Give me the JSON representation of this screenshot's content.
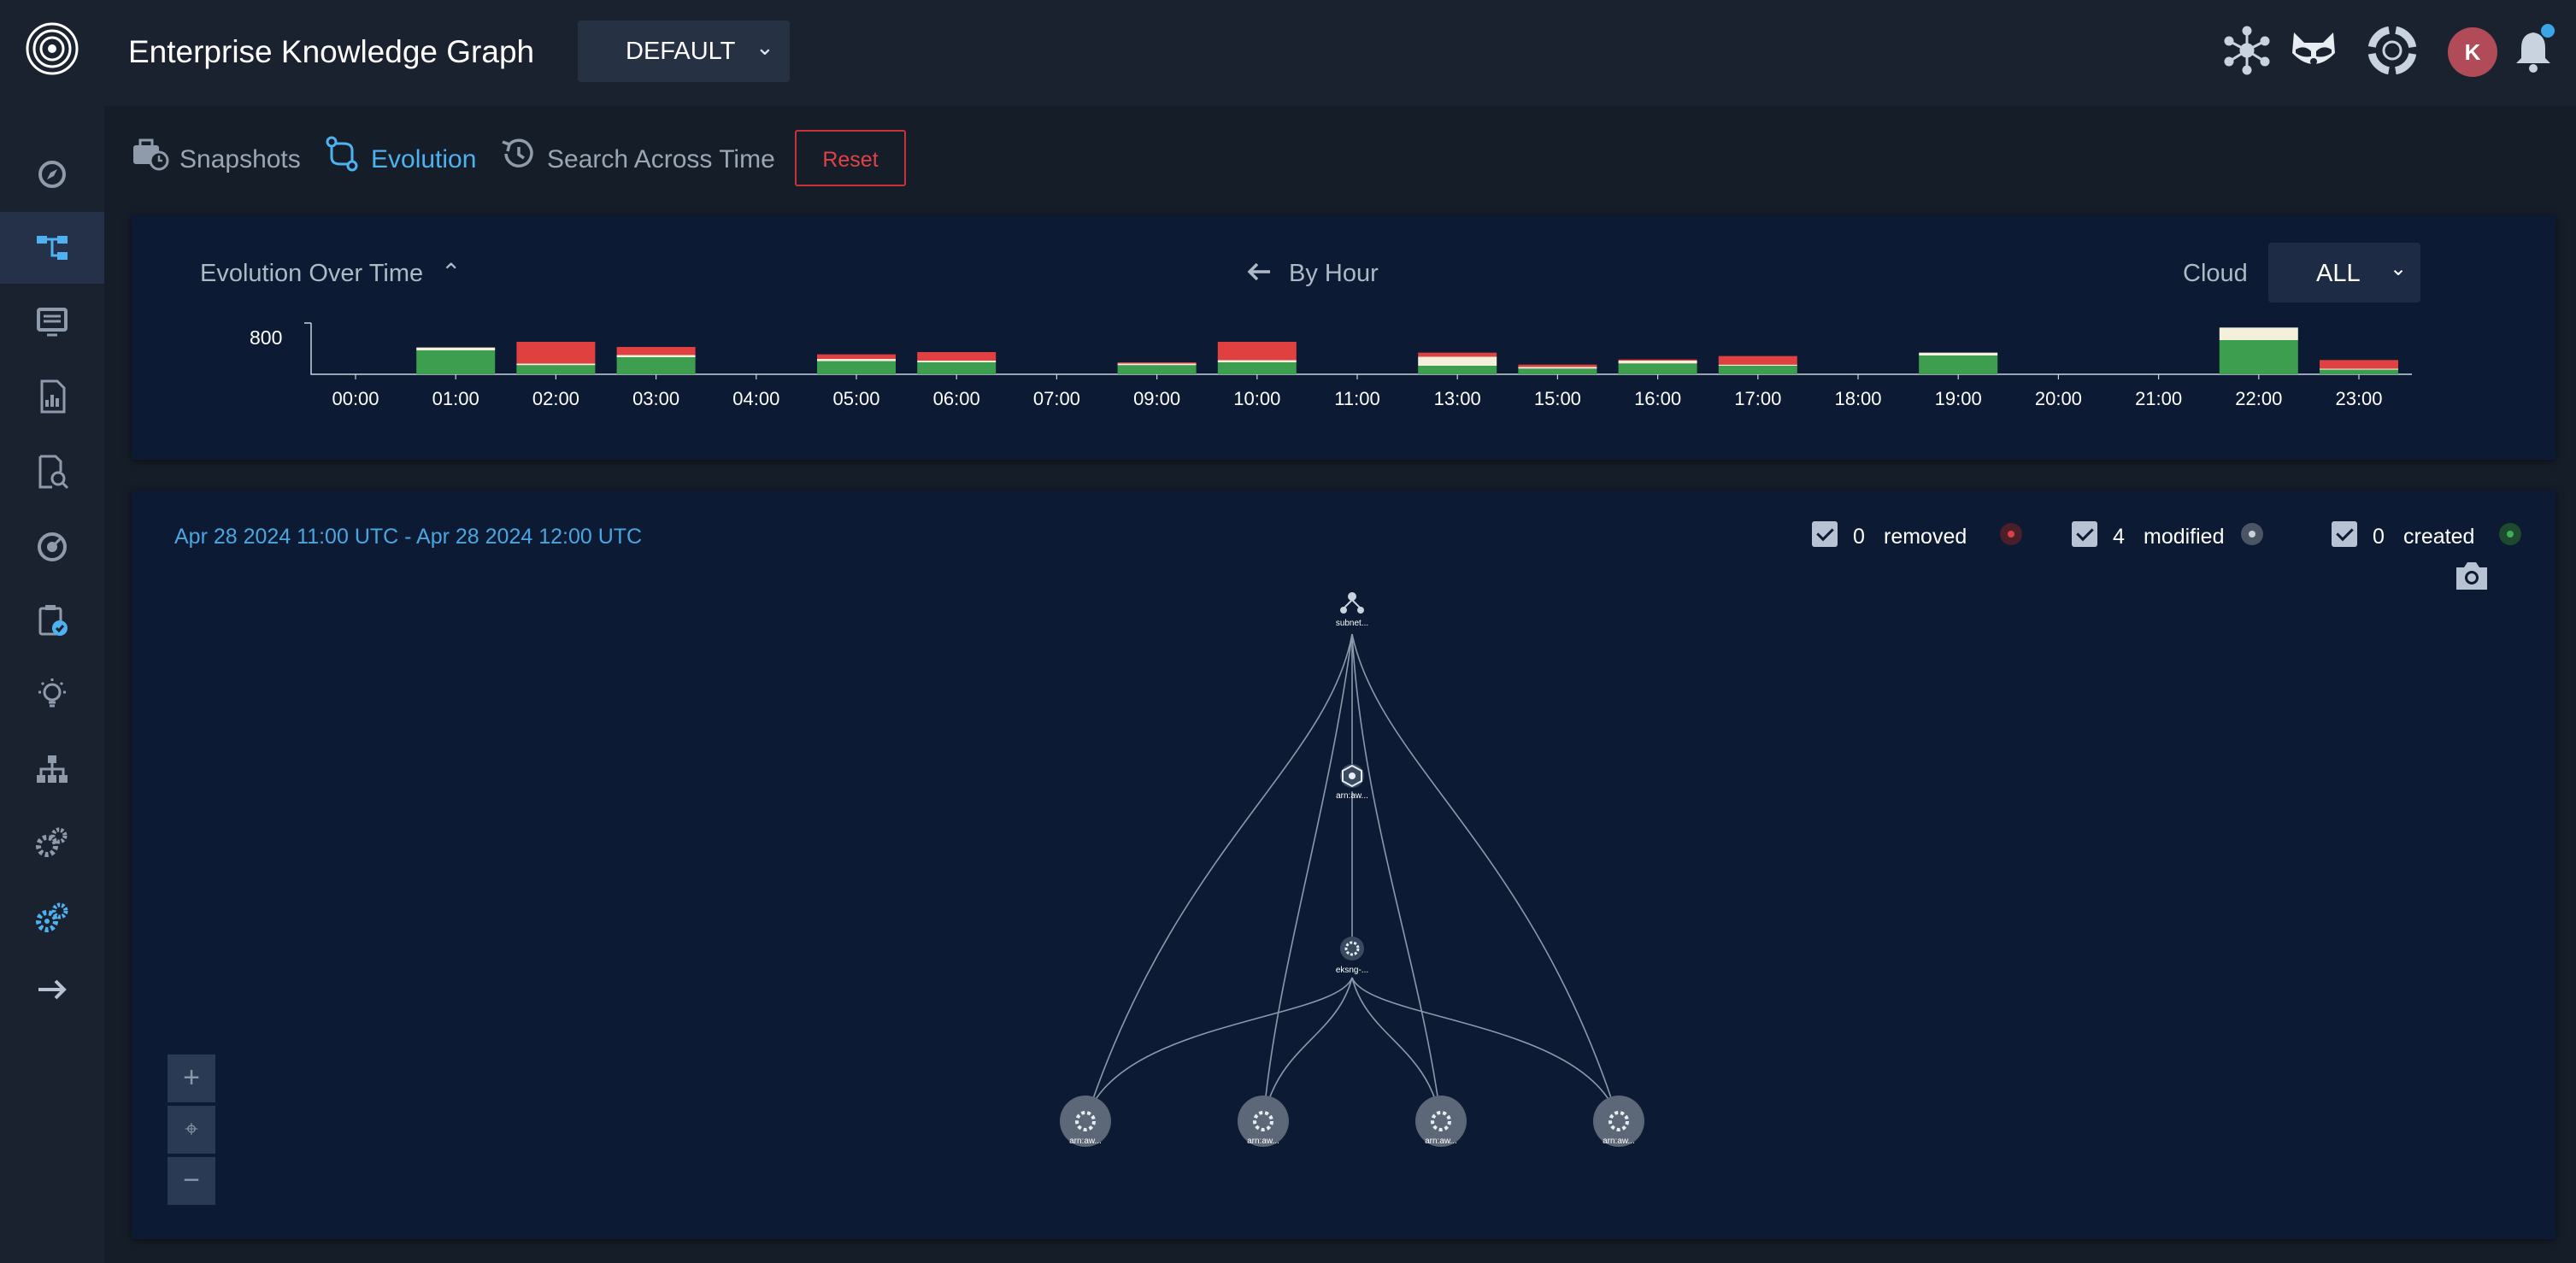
{
  "app": {
    "title": "Enterprise Knowledge Graph",
    "environment": "DEFAULT",
    "user_initial": "K"
  },
  "topbar_icons": [
    "graph-network-icon",
    "raccoon-mascot-icon",
    "lifebuoy-help-icon",
    "user-avatar",
    "notification-bell-icon"
  ],
  "sidebar": {
    "items": [
      {
        "name": "compass-icon",
        "active": false
      },
      {
        "name": "graph-nodes-icon",
        "active": true
      },
      {
        "name": "monitor-list-icon",
        "active": false
      },
      {
        "name": "report-chart-icon",
        "active": false
      },
      {
        "name": "document-search-icon",
        "active": false
      },
      {
        "name": "radar-icon",
        "active": false
      },
      {
        "name": "clipboard-check-icon",
        "active": false
      },
      {
        "name": "bulb-icon",
        "active": false
      },
      {
        "name": "hierarchy-icon",
        "active": false
      },
      {
        "name": "gears-icon",
        "active": false
      },
      {
        "name": "settings-gears-icon",
        "active": false
      },
      {
        "name": "arrow-right-icon",
        "active": false
      }
    ]
  },
  "tabs": [
    {
      "label": "Snapshots",
      "icon": "briefcase-clock-icon",
      "active": false
    },
    {
      "label": "Evolution",
      "icon": "branch-compare-icon",
      "active": true
    },
    {
      "label": "Search Across Time",
      "icon": "history-icon",
      "active": false
    }
  ],
  "reset_label": "Reset",
  "timeline": {
    "title": "Evolution Over Time",
    "granularity": "By Hour",
    "cloud_label": "Cloud",
    "cloud_value": "ALL"
  },
  "chart_data": {
    "type": "bar",
    "stacked": true,
    "categories": [
      "00:00",
      "01:00",
      "02:00",
      "03:00",
      "04:00",
      "05:00",
      "06:00",
      "07:00",
      "09:00",
      "10:00",
      "11:00",
      "13:00",
      "15:00",
      "16:00",
      "17:00",
      "18:00",
      "19:00",
      "20:00",
      "21:00",
      "22:00",
      "23:00"
    ],
    "series": [
      {
        "color": "#3e9e4f",
        "values": [
          0,
          420,
          160,
          300,
          0,
          230,
          210,
          0,
          160,
          210,
          0,
          150,
          100,
          190,
          150,
          0,
          330,
          0,
          0,
          600,
          80
        ]
      },
      {
        "color": "#f5f0dc",
        "values": [
          0,
          50,
          30,
          40,
          0,
          40,
          30,
          0,
          30,
          40,
          0,
          160,
          30,
          50,
          20,
          0,
          50,
          0,
          0,
          220,
          20
        ]
      },
      {
        "color": "#e0403f",
        "values": [
          0,
          0,
          380,
          140,
          0,
          80,
          150,
          0,
          20,
          320,
          0,
          70,
          40,
          20,
          150,
          0,
          0,
          0,
          0,
          0,
          150
        ]
      }
    ],
    "ytick": "800",
    "ylim": [
      0,
      900
    ],
    "grid": false,
    "legend": "none"
  },
  "graph": {
    "range": "Apr 28 2024 11:00 UTC - Apr 28 2024 12:00 UTC",
    "legend": [
      {
        "count": "0",
        "label": "removed",
        "color": "#d9414a"
      },
      {
        "count": "4",
        "label": "modified",
        "color": "#c9d1da"
      },
      {
        "count": "0",
        "label": "created",
        "color": "#3fae57"
      }
    ],
    "nodes": [
      {
        "id": "subnet",
        "label": "subnet..."
      },
      {
        "id": "arn1",
        "label": "arn:aw..."
      },
      {
        "id": "eksng",
        "label": "eksng-..."
      },
      {
        "id": "arn2",
        "label": "arn:aw..."
      },
      {
        "id": "arn3",
        "label": "arn:aw..."
      },
      {
        "id": "arn4",
        "label": "arn:aw..."
      },
      {
        "id": "arn5",
        "label": "arn:aw..."
      }
    ],
    "zoom_controls": [
      "+",
      "⌖",
      "−"
    ]
  }
}
